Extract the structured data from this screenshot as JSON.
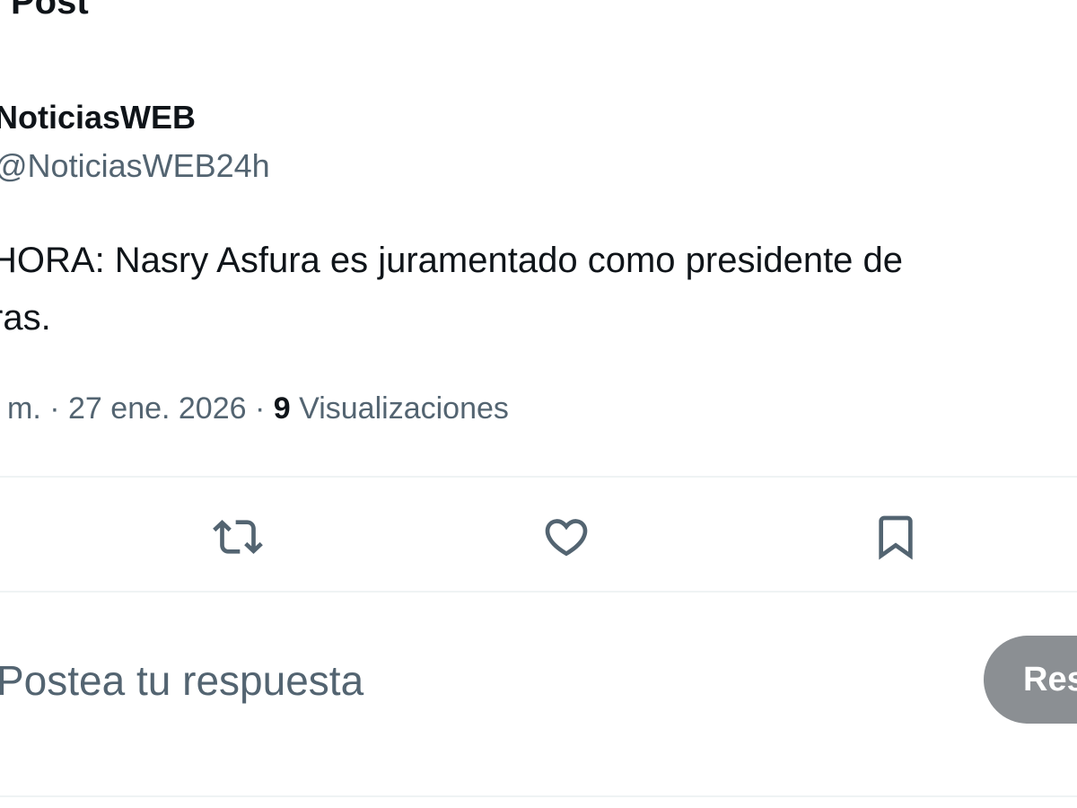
{
  "header": {
    "title": "Post"
  },
  "author": {
    "display_name": "NoticiasWEB",
    "handle": "@NoticiasWEB24h"
  },
  "post": {
    "text_lines": [
      "HORA: Nasry Asfura es juramentado como presidente de",
      "ras."
    ]
  },
  "meta": {
    "time_fragment": "m.",
    "separator": "·",
    "date": "27 ene. 2026",
    "views_count": "9",
    "views_label": "Visualizaciones"
  },
  "actions": {
    "icons": [
      "repost-icon",
      "like-icon",
      "bookmark-icon"
    ],
    "icon_color": "#536471"
  },
  "reply": {
    "placeholder": "Postea tu respuesta",
    "button_label": "Res"
  },
  "colors": {
    "text_primary": "#0f1419",
    "text_secondary": "#536471",
    "divider": "#eff3f4",
    "reply_button_bg": "#8b8f93"
  }
}
